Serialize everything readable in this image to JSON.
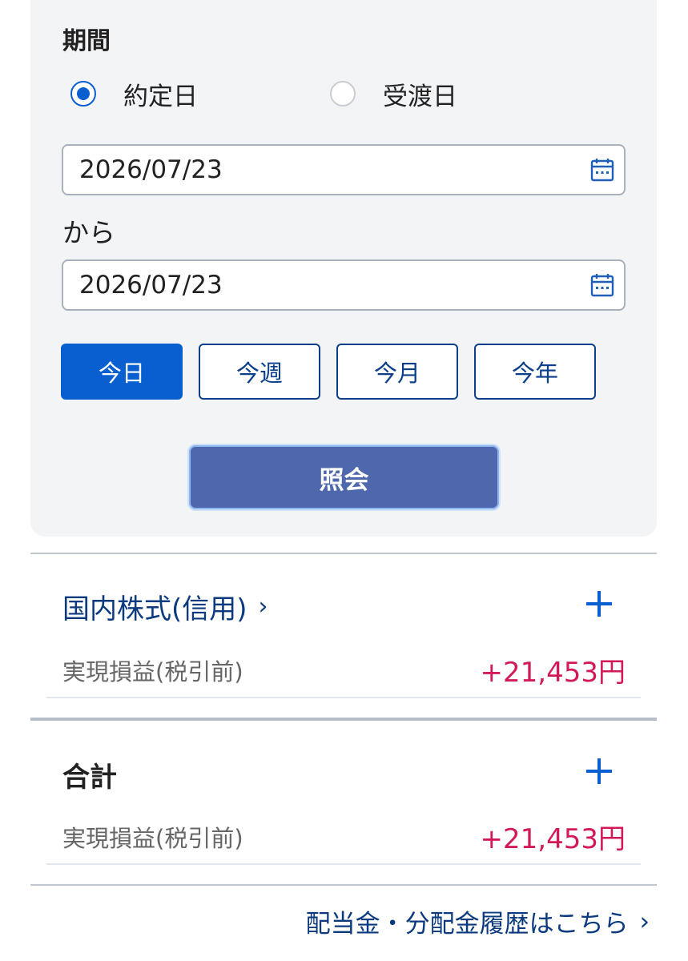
{
  "period": {
    "label": "期間",
    "options": [
      {
        "label": "約定日",
        "selected": true
      },
      {
        "label": "受渡日",
        "selected": false
      }
    ],
    "from_date": "2026/07/23",
    "from_suffix": "から",
    "to_date": "2026/07/23",
    "quick_buttons": [
      "今日",
      "今週",
      "今月",
      "今年"
    ],
    "active_quick": "今日",
    "search_label": "照会"
  },
  "sections": [
    {
      "title": "国内株式(信用)",
      "chevron": "›",
      "pl_label": "実現損益(税引前)",
      "pl_value": "+21,453円"
    },
    {
      "title": "合計",
      "pl_label": "実現損益(税引前)",
      "pl_value": "+21,453円"
    }
  ],
  "footer": {
    "link_label": "配当金・分配金履歴はこちら",
    "chevron": "›"
  },
  "icons": {
    "calendar": "calendar-icon",
    "expand": "plus-icon",
    "chevron": "chevron-right-icon"
  },
  "colors": {
    "accent": "#0a5fd0",
    "navy": "#0b3a7e",
    "positive": "#d21a5a",
    "search_button": "#4f68ad"
  }
}
